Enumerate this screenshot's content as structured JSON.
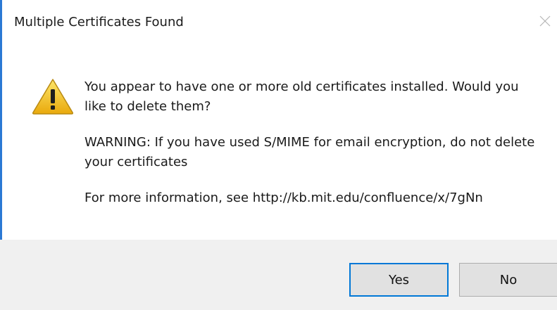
{
  "dialog": {
    "title": "Multiple Certificates Found",
    "icon": "warning-icon",
    "message_line_1": "You appear to have one or more old certificates installed. Would you like to delete them?",
    "message_line_2": "WARNING: If you have used S/MIME for email encryption, do not delete your certificates",
    "message_line_3": "For more information, see http://kb.mit.edu/confluence/x/7gNn"
  },
  "buttons": {
    "yes_label": "Yes",
    "no_label": "No"
  },
  "colors": {
    "accent": "#0078d7",
    "button_bar": "#f0f0f0",
    "button_face": "#e1e1e1",
    "warning_yellow": "#f5c518"
  }
}
